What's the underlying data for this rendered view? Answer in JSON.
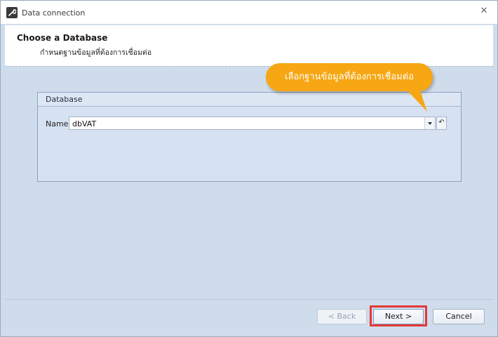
{
  "window": {
    "title": "Data connection",
    "icon": "wrench-icon",
    "close_glyph": "✕"
  },
  "header": {
    "title": "Choose a Database",
    "subtitle": "กำหนดฐานข้อมูลที่ต้องการเชื่อมต่อ"
  },
  "database_group": {
    "caption": "Database",
    "name_label": "Name",
    "name_value": "dbVAT",
    "reset_glyph": "↶"
  },
  "callout": {
    "text": "เลือกฐานข้อมูลที่ต้องการเชื่อมต่อ",
    "color": "#f6a713"
  },
  "footer": {
    "back_label": "< Back",
    "next_label": "Next >",
    "cancel_label": "Cancel",
    "highlight_color": "#e53935"
  }
}
